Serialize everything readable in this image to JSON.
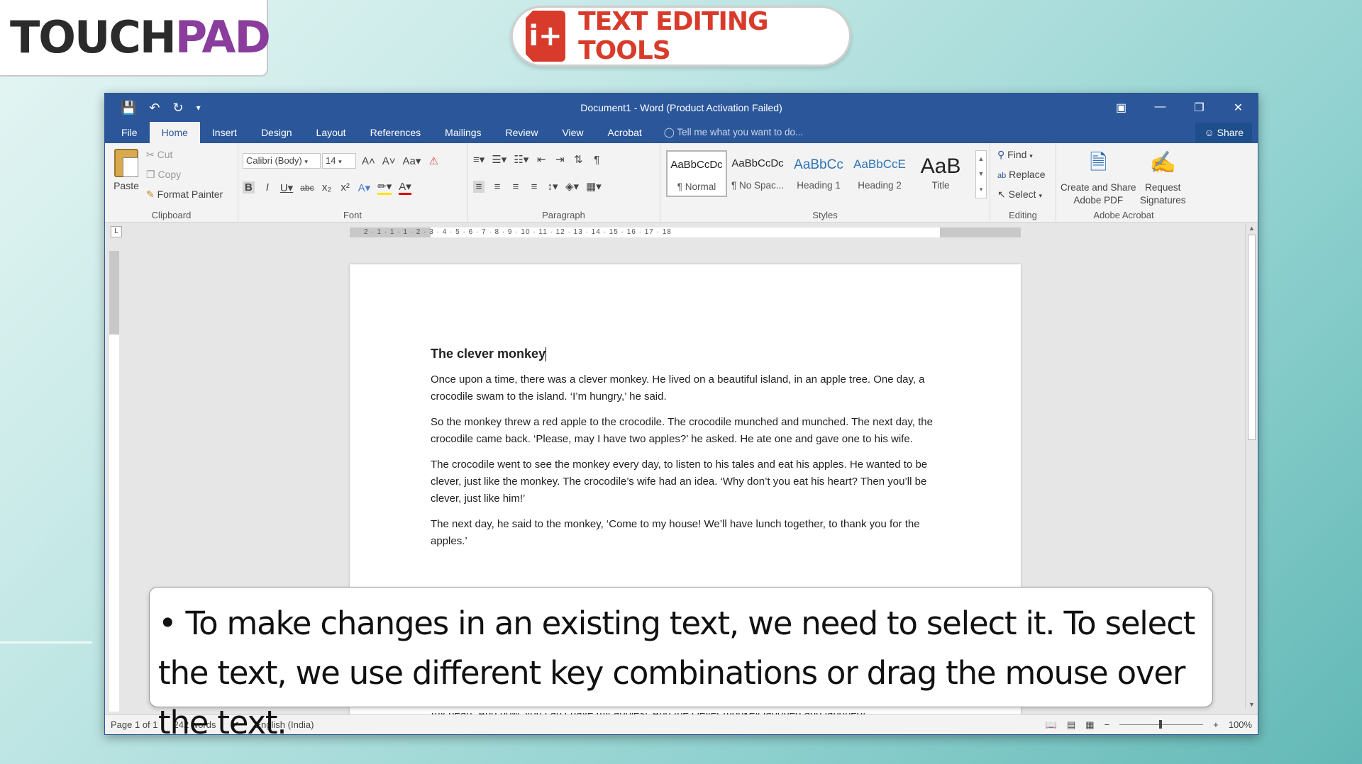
{
  "branding": {
    "logo_touch": "TOUCH",
    "logo_pad": "PAD",
    "badge_icon": "i+",
    "badge_title": "TEXT EDITING TOOLS"
  },
  "window": {
    "title": "Document1 - Word (Product Activation Failed)",
    "controls": [
      "ribbon-display-icon",
      "minimize-icon",
      "restore-icon",
      "close-icon"
    ]
  },
  "qat": {
    "icons": [
      "save-icon",
      "undo-icon",
      "redo-icon",
      "customize-icon"
    ]
  },
  "tabs": [
    "File",
    "Home",
    "Insert",
    "Design",
    "Layout",
    "References",
    "Mailings",
    "Review",
    "View",
    "Acrobat"
  ],
  "active_tab": "Home",
  "tell_me": "Tell me what you want to do...",
  "share": "Share",
  "clipboard": {
    "paste": "Paste",
    "cut": "Cut",
    "copy": "Copy",
    "format_painter": "Format Painter",
    "label": "Clipboard"
  },
  "font": {
    "family": "Calibri (Body)",
    "size": "14",
    "label": "Font"
  },
  "paragraph": {
    "label": "Paragraph"
  },
  "styles": {
    "items": [
      {
        "sample": "AaBbCcDc",
        "name": "¶ Normal"
      },
      {
        "sample": "AaBbCcDc",
        "name": "¶ No Spac..."
      },
      {
        "sample": "AaBbCc",
        "name": "Heading 1"
      },
      {
        "sample": "AaBbCcE",
        "name": "Heading 2"
      },
      {
        "sample": "AaB",
        "name": "Title"
      }
    ],
    "label": "Styles"
  },
  "editing": {
    "find": "Find",
    "replace": "Replace",
    "select": "Select",
    "label": "Editing"
  },
  "acrobat": {
    "create": "Create and Share",
    "create2": "Adobe PDF",
    "request": "Request",
    "request2": "Signatures",
    "label": "Adobe Acrobat"
  },
  "ruler": "2 · 1 · 1 · 1 · 2 · 3 · 4 · 5 · 6 · 7 · 8 · 9 · 10 · 11 · 12 · 13 · 14 · 15 · 16 · 17 · 18",
  "document": {
    "heading": "The clever monkey",
    "paragraphs": [
      "Once upon a time, there was a clever monkey. He lived on a beautiful island, in an apple tree. One day, a crocodile swam to the island. ‘I’m hungry,’ he said.",
      "So the monkey threw a red apple to the crocodile. The crocodile munched and munched. The next day, the crocodile came back. ‘Please, may I have two apples?’ he asked. He ate one and gave one to his wife.",
      "The crocodile went to see the monkey every day, to listen to his tales and eat his apples. He wanted to be clever, just like the monkey. The crocodile’s wife had an idea. ‘Why don’t you eat his heart? Then you’ll be clever, just like him!’",
      "The next day, he said to the monkey, ‘Come to my house! We’ll have lunch together, to thank you for the apples.’"
    ],
    "cutoff_line": "my heart. And now, you can’t have my apples!’ And the clever monkey laughed and laughed!"
  },
  "status": {
    "page": "Page 1 of 1",
    "words": "242 words",
    "language": "English (India)",
    "zoom": "100%"
  },
  "caption": "• To make changes in an existing text, we need to select it. To select the text, we use different key combinations or drag the mouse over the text."
}
